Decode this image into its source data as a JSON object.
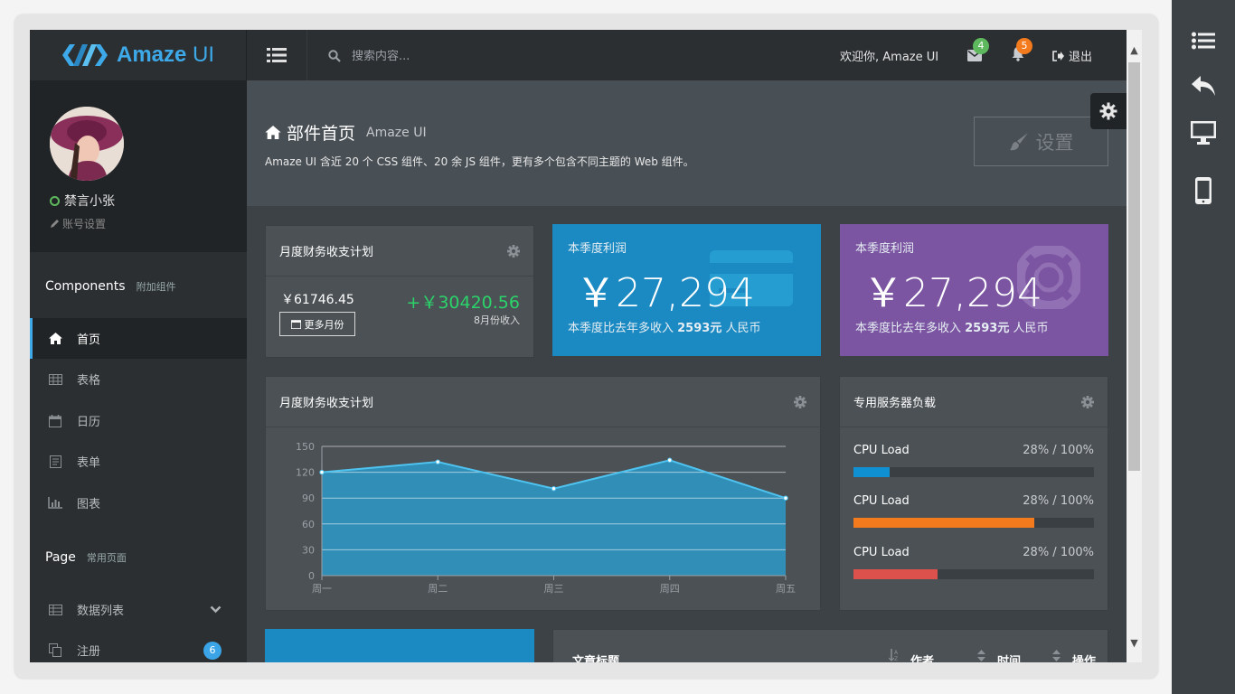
{
  "topbar": {
    "logo_text_bold": "Amaze",
    "logo_text_light": "UI",
    "search_placeholder": "搜索内容...",
    "welcome": "欢迎你, Amaze UI",
    "mail_count": "4",
    "bell_count": "5",
    "logout": "退出",
    "colors": {
      "mail_badge": "#5eb95e",
      "bell_badge": "#f37b1d",
      "brand": "#3ea9e8"
    }
  },
  "user": {
    "name": "禁言小张",
    "account_settings": "账号设置"
  },
  "sidebar": {
    "section1": {
      "title": "Components",
      "subtitle": "附加组件"
    },
    "items": [
      {
        "label": "首页",
        "icon": "home-icon"
      },
      {
        "label": "表格",
        "icon": "table-icon"
      },
      {
        "label": "日历",
        "icon": "calendar-icon"
      },
      {
        "label": "表单",
        "icon": "form-icon"
      },
      {
        "label": "图表",
        "icon": "chart-icon"
      }
    ],
    "section2": {
      "title": "Page",
      "subtitle": "常用页面"
    },
    "items2": [
      {
        "label": "数据列表",
        "icon": "table-icon"
      },
      {
        "label": "注册",
        "icon": "copy-icon",
        "count": "6"
      }
    ]
  },
  "page_header": {
    "title": "部件首页",
    "title_sub": "Amaze UI",
    "description": "Amaze UI 含近 20 个 CSS 组件、20 余 JS 组件，更有多个包含不同主题的 Web 组件。",
    "settings_button": "设置"
  },
  "finance_card": {
    "title": "月度财务收支计划",
    "amount": "￥61746.45",
    "income": "+￥30420.56",
    "income_label": "8月份收入",
    "more_button": "更多月份"
  },
  "stat_cards": [
    {
      "label": "本季度利润",
      "value": "￥27,294",
      "sub_prefix": "本季度比去年多收入 ",
      "sub_bold": "2593元",
      "sub_suffix": " 人民币",
      "color": "#1c8ac2",
      "icon": "credit-card-icon"
    },
    {
      "label": "本季度利润",
      "value": "￥27,294",
      "sub_prefix": "本季度比去年多收入 ",
      "sub_bold": "2593元",
      "sub_suffix": " 人民币",
      "color": "#7b55a1",
      "icon": "lifebuoy-icon"
    }
  ],
  "chart_card": {
    "title": "月度财务收支计划"
  },
  "chart_data": {
    "type": "area",
    "categories": [
      "周一",
      "周二",
      "周三",
      "周四",
      "周五"
    ],
    "series": [
      {
        "values": [
          120,
          132,
          101,
          134,
          90
        ]
      }
    ],
    "ylim": [
      0,
      150
    ],
    "yticks": [
      0,
      30,
      60,
      90,
      120,
      150
    ],
    "grid": true,
    "color": "#2a9fd0"
  },
  "server_card": {
    "title": "专用服务器负载",
    "rows": [
      {
        "label": "CPU Load",
        "value": "28% / 100%",
        "fill": 0.15,
        "color": "#0e90d2"
      },
      {
        "label": "CPU Load",
        "value": "28% / 100%",
        "fill": 0.75,
        "color": "#f37b1d"
      },
      {
        "label": "CPU Load",
        "value": "28% / 100%",
        "fill": 0.35,
        "color": "#dd514c"
      }
    ]
  },
  "table_card": {
    "headers": [
      "文章标题",
      "作者",
      "时间",
      "操作"
    ]
  }
}
